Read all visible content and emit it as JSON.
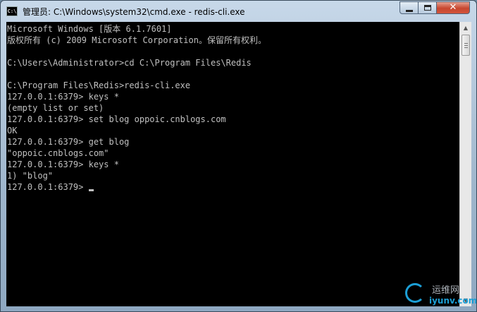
{
  "window": {
    "title": "管理员: C:\\Windows\\system32\\cmd.exe - redis-cli.exe",
    "app_icon_text": "C:\\",
    "controls": {
      "minimize_icon": "minimize-icon",
      "maximize_icon": "maximize-icon",
      "close_icon": "close-icon",
      "close_glyph": "✕"
    }
  },
  "console": {
    "lines": [
      "Microsoft Windows [版本 6.1.7601]",
      "版权所有 (c) 2009 Microsoft Corporation。保留所有权利。",
      "",
      "C:\\Users\\Administrator>cd C:\\Program Files\\Redis",
      "",
      "C:\\Program Files\\Redis>redis-cli.exe",
      "127.0.0.1:6379> keys *",
      "(empty list or set)",
      "127.0.0.1:6379> set blog oppoic.cnblogs.com",
      "OK",
      "127.0.0.1:6379> get blog",
      "\"oppoic.cnblogs.com\"",
      "127.0.0.1:6379> keys *",
      "1) \"blog\""
    ],
    "prompt": "127.0.0.1:6379> ",
    "text_color": "#c0c0c0",
    "background": "#000000"
  },
  "watermark": {
    "cn": "运维网",
    "en": "iyunv.com"
  }
}
